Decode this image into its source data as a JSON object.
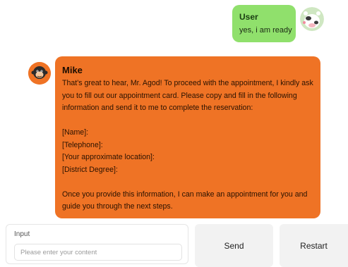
{
  "user_message": {
    "name": "User",
    "text": "yes, i am ready"
  },
  "bot_message": {
    "name": "Mike",
    "lines": [
      "That's great to hear, Mr. Agod! To proceed with the appointment, I kindly ask",
      "you to fill out our appointment card. Please copy and fill in the following",
      "information and send it to me to complete the reservation:",
      "",
      "[Name]:",
      "[Telephone]:",
      "[Your approximate location]:",
      "[District Degree]:",
      "",
      "Once you provide this information, I can make an appointment for you and",
      "guide you through the next steps."
    ]
  },
  "input": {
    "label": "Input",
    "placeholder": "Please enter your content"
  },
  "buttons": {
    "send": "Send",
    "restart": "Restart"
  },
  "colors": {
    "user_bubble": "#90e06c",
    "bot_bubble": "#ef7325",
    "button_bg": "#f2f2f2"
  },
  "icons": {
    "user_avatar": "cartoon-cow-avatar-icon",
    "bot_avatar": "monkey-avatar-icon"
  }
}
